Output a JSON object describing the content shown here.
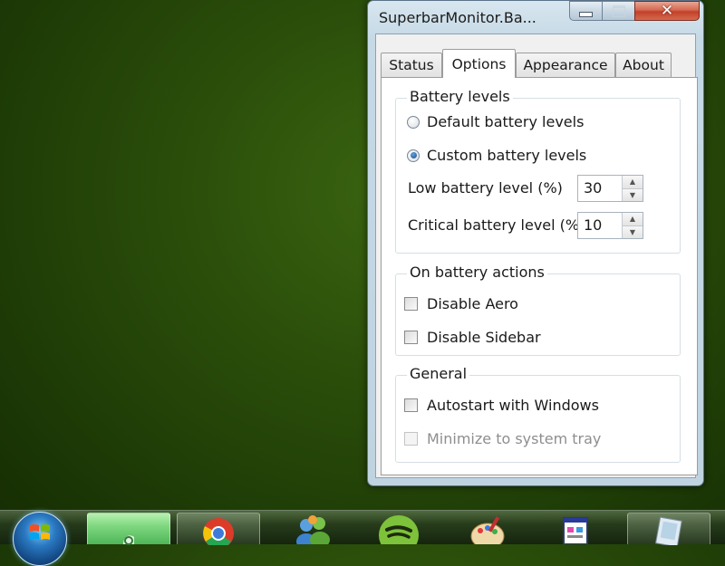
{
  "window": {
    "title": "SuperbarMonitor.Ba...",
    "close_glyph": "✕"
  },
  "tabs": [
    {
      "label": "Status",
      "active": false
    },
    {
      "label": "Options",
      "active": true
    },
    {
      "label": "Appearance",
      "active": false
    },
    {
      "label": "About",
      "active": false
    }
  ],
  "battery_levels": {
    "title": "Battery levels",
    "default_label": "Default battery levels",
    "custom_label": "Custom battery levels",
    "selected": "custom",
    "low_label": "Low battery level (%)",
    "low_value": "30",
    "critical_label": "Critical battery level (%)",
    "critical_value": "10"
  },
  "on_battery_actions": {
    "title": "On battery actions",
    "disable_aero_label": "Disable Aero",
    "disable_aero_checked": false,
    "disable_sidebar_label": "Disable Sidebar",
    "disable_sidebar_checked": false
  },
  "general": {
    "title": "General",
    "autostart_label": "Autostart with Windows",
    "autostart_checked": false,
    "minimize_label": "Minimize to system tray",
    "minimize_enabled": false
  },
  "taskbar": {
    "items": [
      "start-orb",
      "active-app-icon",
      "chrome-icon",
      "messenger-icon",
      "spotify-icon",
      "paint-icon",
      "window-app-icon",
      "document-app-icon"
    ]
  },
  "colors": {
    "desktop": "#2a4d0a",
    "window_frame": "#c5d9e6",
    "close_button": "#c2402a"
  }
}
